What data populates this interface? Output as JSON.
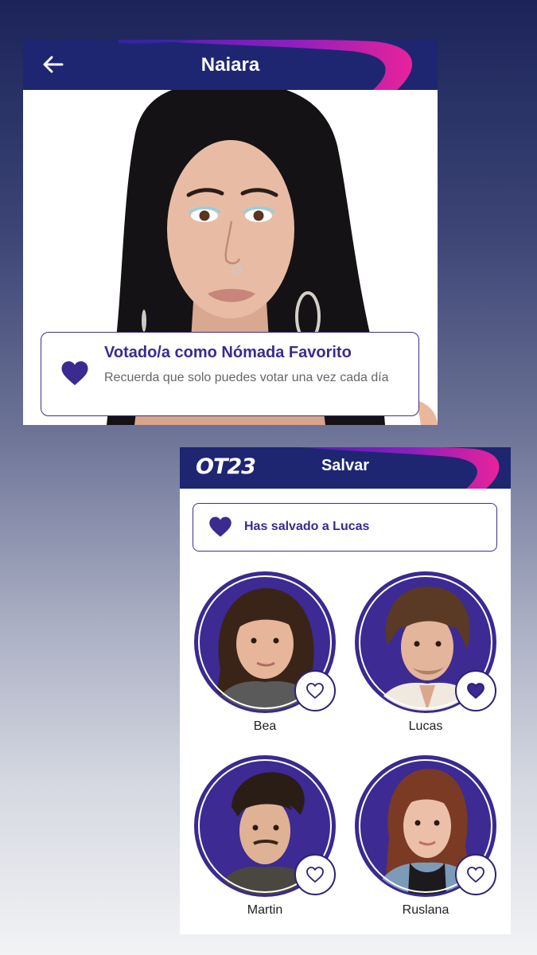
{
  "profile_screen": {
    "title": "Naiara",
    "back_icon": "arrow-left-icon",
    "vote_card": {
      "icon": "heart-filled-icon",
      "title": "Votado/a como Nómada Favorito",
      "subtitle": "Recuerda que solo puedes votar una vez cada día"
    }
  },
  "save_screen": {
    "logo_text": "OT23",
    "title": "Salvar",
    "saved_banner": {
      "icon": "heart-filled-icon",
      "text": "Has salvado a Lucas"
    },
    "contestants": [
      {
        "name": "Bea",
        "favorited": false
      },
      {
        "name": "Lucas",
        "favorited": true
      },
      {
        "name": "Martin",
        "favorited": false
      },
      {
        "name": "Ruslana",
        "favorited": false
      }
    ]
  },
  "colors": {
    "brand_navy": "#1e2672",
    "accent_purple": "#3b2a8f",
    "swoosh_magenta": "#e0239b"
  }
}
